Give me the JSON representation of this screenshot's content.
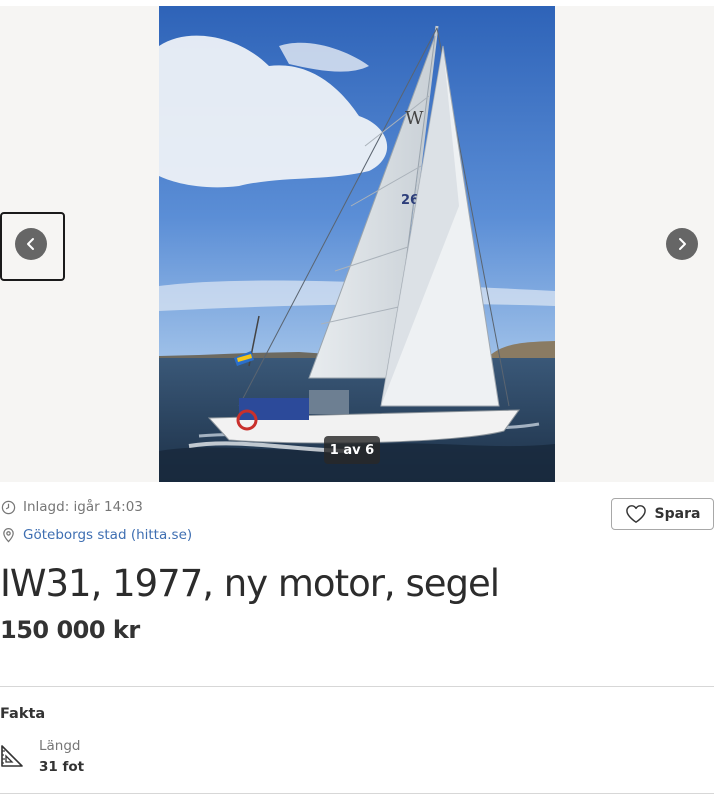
{
  "gallery": {
    "counter": "1 av 6",
    "image_alt": "Sailboat IW31 under sail",
    "sail_number": "261",
    "prev_icon": "chevron-left-icon",
    "next_icon": "chevron-right-icon"
  },
  "meta": {
    "posted_icon": "clock-icon",
    "posted": "Inlagd: igår 14:03",
    "location_icon": "map-pin-icon",
    "location": "Göteborgs stad (hitta.se)"
  },
  "save": {
    "icon": "heart-icon",
    "label": "Spara"
  },
  "listing": {
    "title": "IW31, 1977, ny motor, segel",
    "price": "150 000 kr"
  },
  "facts": {
    "heading": "Fakta",
    "items": [
      {
        "icon": "ruler-triangle-icon",
        "label": "Längd",
        "value": "31 fot"
      }
    ]
  },
  "colors": {
    "link": "#3f6fb2",
    "muted": "#767676",
    "text": "#333333",
    "nav_button": "#666666"
  }
}
